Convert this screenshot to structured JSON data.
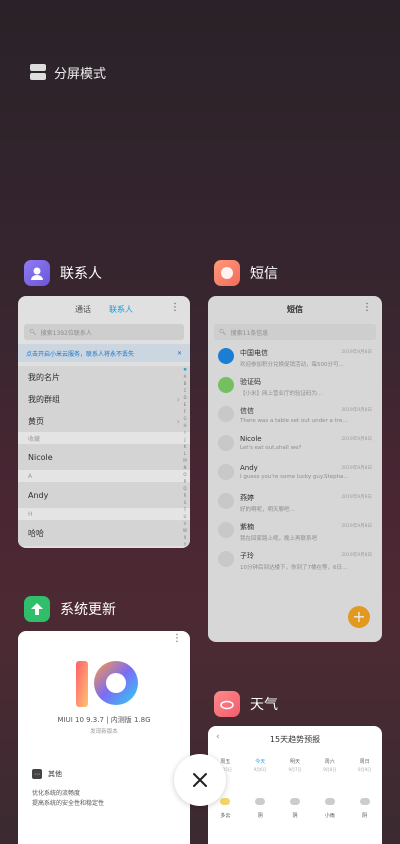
{
  "split_screen": {
    "label": "分屏模式",
    "icon": "split-screen-icon"
  },
  "apps": {
    "contacts": {
      "name": "联系人",
      "icon": "contacts-app-icon",
      "tabs": [
        "通话",
        "联系人"
      ],
      "search_placeholder": "搜索1392位联系人",
      "banner": "点击开启小米云服务，联系人将永不丢失",
      "rows": {
        "card": "我的名片",
        "groups": "我的群组",
        "yellow": "黄页"
      },
      "sections": {
        "fav": "收藏",
        "a": "A",
        "h": "H"
      },
      "names": {
        "nicole": "Nicole",
        "andy": "Andy",
        "haha": "哈哈"
      },
      "alphabet": [
        "♥",
        "A",
        "B",
        "C",
        "D",
        "E",
        "F",
        "G",
        "H",
        "I",
        "J",
        "K",
        "L",
        "M",
        "N",
        "O",
        "P",
        "Q",
        "R",
        "S",
        "T",
        "U",
        "V",
        "W",
        "X",
        "Y",
        "Z",
        "#"
      ]
    },
    "sms": {
      "name": "短信",
      "icon": "sms-app-icon",
      "title": "短信",
      "search_placeholder": "搜索11条信息",
      "messages": [
        {
          "name": "中国电信",
          "text": "欢迎参加积分兑换促销活动，每500分可…",
          "time": "2019年9月8日"
        },
        {
          "name": "验证码",
          "text": "【小米】网上营业厅的验证码为…",
          "time": ""
        },
        {
          "name": "信信",
          "text": "There was a table set out under a tree i…",
          "time": "2019年9月8日"
        },
        {
          "name": "Nicole",
          "text": "Let's eat out,shall we?",
          "time": "2019年9月8日"
        },
        {
          "name": "Andy",
          "text": "I guess you're some lucky guy.Stepha…",
          "time": "2019年9月8日"
        },
        {
          "name": "燕婷",
          "text": "好的啊呢，明天聊吧…",
          "time": "2019年9月8日"
        },
        {
          "name": "紫楠",
          "text": "我在回家路上呢，晚上再联系吧",
          "time": "2019年9月8日"
        },
        {
          "name": "子玲",
          "text": "10分钟后到达楼下，你到了7楼在等，6日…",
          "time": "2019年9月8日"
        }
      ]
    },
    "update": {
      "name": "系统更新",
      "icon": "system-update-app-icon",
      "version": "MIUI 10 9.3.7 | 内测版 1.8G",
      "subtitle": "发现新版本",
      "other_label": "其他",
      "lines": [
        "优化系统的流畅度",
        "提高系统的安全性和稳定性"
      ]
    },
    "weather": {
      "name": "天气",
      "icon": "weather-app-icon",
      "title": "15天趋势预报",
      "days": [
        {
          "d": "周五",
          "date": "9月5日"
        },
        {
          "d": "今天",
          "date": "9月6日"
        },
        {
          "d": "明天",
          "date": "9月7日"
        },
        {
          "d": "周六",
          "date": "9月8日"
        },
        {
          "d": "周日",
          "date": "9月9日"
        }
      ],
      "conditions": [
        "多云",
        "阴",
        "阴",
        "小雨",
        "阴"
      ]
    }
  },
  "close_button": {
    "icon": "close-icon"
  }
}
